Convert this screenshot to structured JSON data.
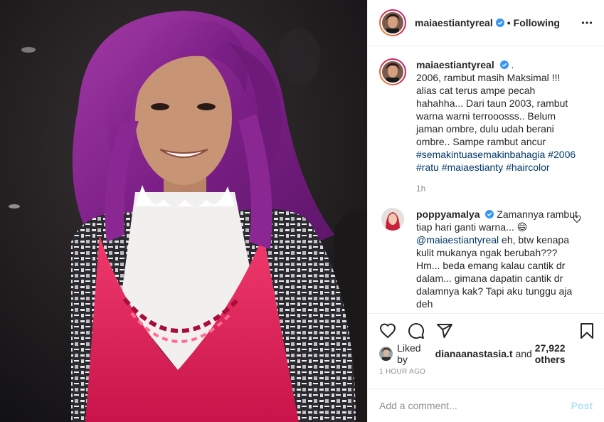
{
  "header": {
    "username": "maiaestiantyreal",
    "follow_status": "Following",
    "separator": "•"
  },
  "caption": {
    "username": "maiaestiantyreal",
    "suffix": ".",
    "body": "2006, rambut masih Maksimal !!! alias cat terus ampe pecah hahahha... Dari taun 2003, rambut warna warni terrooosss.. Belum jaman ombre, dulu udah berani ombre.. Sampe rambut ancur",
    "hashtags": [
      "#semakintuasemakinbahagia",
      "#2006",
      "#ratu",
      "#maiaestianty",
      "#haircolor"
    ],
    "time": "1h"
  },
  "comment": {
    "username": "poppyamalya",
    "text_1": "Zamannya rambut tiap hari ganti warna...",
    "emoji": "😄",
    "mention": "@maiaestiantyreal",
    "text_2": "eh, btw kenapa kulit mukanya ngak berubah??? Hm... beda emang kalau cantik dr dalam... gimana dapatin cantik dr dalamnya",
    "text_3": "kak? Tapi aku tunggu aja deh"
  },
  "likes": {
    "prefix": "Liked by",
    "first_user": "dianaanastasia.t",
    "middle": "and",
    "others": "27,922 others"
  },
  "timestamp": "1 HOUR AGO",
  "add_comment": {
    "placeholder": "Add a comment...",
    "post_label": "Post"
  },
  "colors": {
    "verified": "#3897f0",
    "link": "#00376b",
    "post_disabled": "#b2dffc",
    "hair": "#8e2a8e",
    "top": "#e0285a"
  },
  "icons": {
    "like": "heart-icon",
    "comment": "comment-icon",
    "share": "paper-plane-icon",
    "save": "bookmark-icon",
    "options": "more-options-icon",
    "verified": "verified-badge-icon"
  }
}
